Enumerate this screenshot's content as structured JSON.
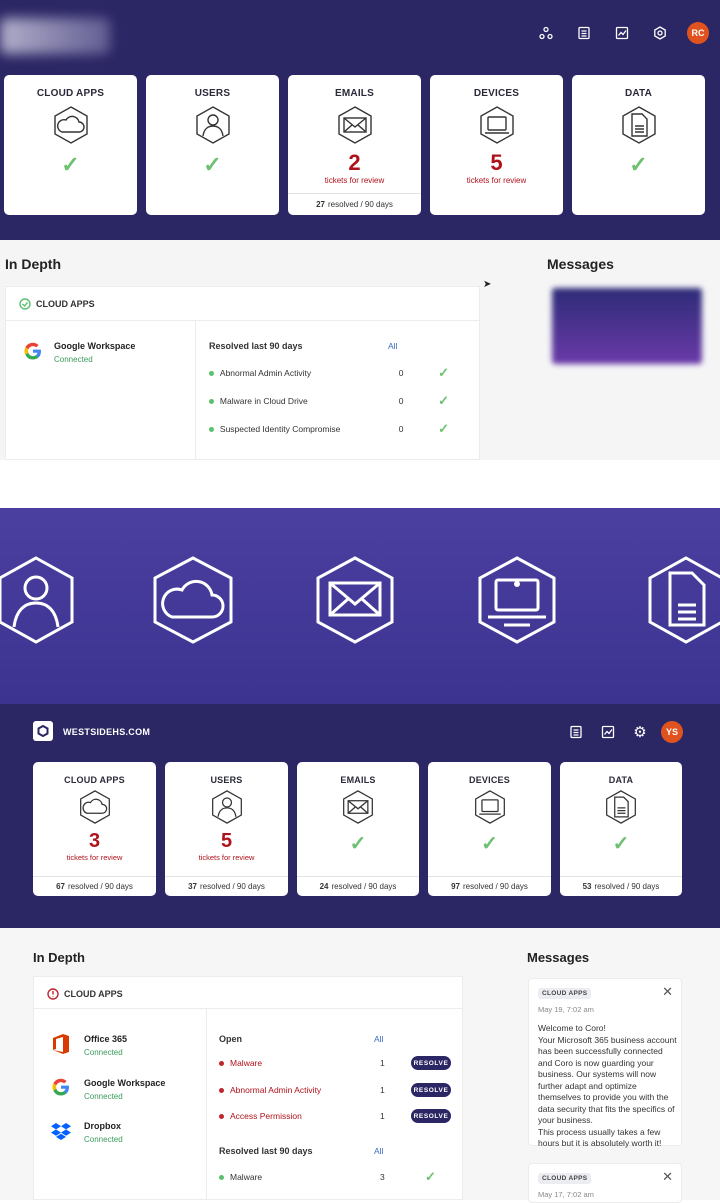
{
  "top": {
    "avatar": "RC",
    "cards": [
      {
        "title": "CLOUD APPS",
        "icon": "cloud-icon",
        "status": "ok"
      },
      {
        "title": "USERS",
        "icon": "user-icon",
        "status": "ok"
      },
      {
        "title": "EMAILS",
        "icon": "email-icon",
        "count": "2",
        "count_label": "tickets for review",
        "resolved": "27",
        "resolved_label": "resolved / 90 days"
      },
      {
        "title": "DEVICES",
        "icon": "laptop-icon",
        "count": "5",
        "count_label": "tickets for review"
      },
      {
        "title": "DATA",
        "icon": "document-icon",
        "status": "ok"
      }
    ],
    "in_depth_title": "In Depth",
    "messages_title": "Messages",
    "panel_header": "CLOUD APPS",
    "connector": {
      "name": "Google Workspace",
      "status": "Connected"
    },
    "resolved_header": "Resolved last 90 days",
    "all_link": "All",
    "resolved_rows": [
      {
        "label": "Abnormal Admin Activity",
        "count": "0"
      },
      {
        "label": "Malware in Cloud Drive",
        "count": "0"
      },
      {
        "label": "Suspected Identity Compromise",
        "count": "0"
      }
    ]
  },
  "hero": {
    "icons": [
      "user-icon",
      "cloud-icon",
      "email-icon",
      "laptop-icon",
      "document-icon"
    ]
  },
  "lower": {
    "workspace": "WESTSIDEHS.COM",
    "avatar": "YS",
    "cards": [
      {
        "title": "CLOUD APPS",
        "count": "3",
        "count_label": "tickets for review",
        "resolved": "67",
        "resolved_label": "resolved / 90 days"
      },
      {
        "title": "USERS",
        "count": "5",
        "count_label": "tickets for review",
        "resolved": "37",
        "resolved_label": "resolved / 90 days"
      },
      {
        "title": "EMAILS",
        "status": "ok",
        "resolved": "24",
        "resolved_label": "resolved / 90 days"
      },
      {
        "title": "DEVICES",
        "status": "ok",
        "resolved": "97",
        "resolved_label": "resolved / 90 days"
      },
      {
        "title": "DATA",
        "status": "ok",
        "resolved": "53",
        "resolved_label": "resolved / 90 days"
      }
    ],
    "in_depth_title": "In Depth",
    "messages_title": "Messages",
    "panel_header": "CLOUD APPS",
    "connectors": [
      {
        "name": "Office 365",
        "status": "Connected"
      },
      {
        "name": "Google Workspace",
        "status": "Connected"
      },
      {
        "name": "Dropbox",
        "status": "Connected"
      }
    ],
    "open_header": "Open",
    "all_link": "All",
    "open_rows": [
      {
        "label": "Malware",
        "count": "1",
        "action": "RESOLVE"
      },
      {
        "label": "Abnormal Admin Activity",
        "count": "1",
        "action": "RESOLVE"
      },
      {
        "label": "Access Permission",
        "count": "1",
        "action": "RESOLVE"
      }
    ],
    "resolved_header": "Resolved last 90 days",
    "resolved_rows": [
      {
        "label": "Malware",
        "count": "3"
      }
    ],
    "messages": [
      {
        "badge": "CLOUD APPS",
        "time": "May 19, 7:02 am",
        "body": "Welcome to Coro!\nYour Microsoft 365 business account has been successfully connected and Coro is now guarding your business. Our systems will now further adapt and optimize themselves to provide you with the data security that fits the specifics of your business.\nThis process usually takes a few hours but it is absolutely worth it!"
      },
      {
        "badge": "CLOUD APPS",
        "time": "May 17, 7:02 am"
      }
    ]
  },
  "colors": {
    "navy": "#2b2664",
    "hero": "#4b3fa0",
    "alert_red": "#b0121b",
    "ok_green": "#6cc070",
    "avatar": "#e0531f"
  }
}
